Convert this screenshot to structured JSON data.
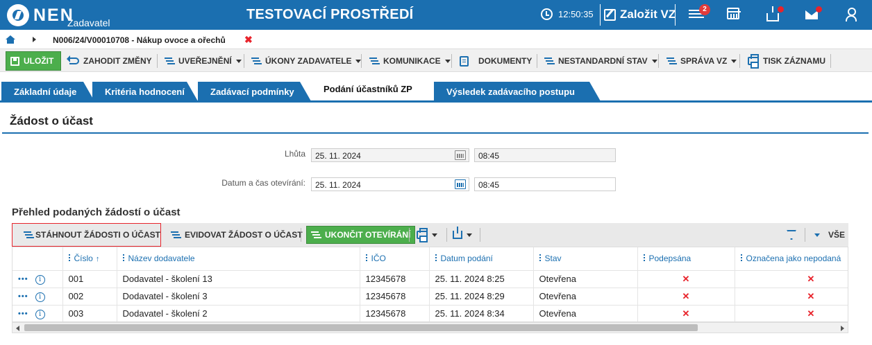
{
  "header": {
    "logo_text": "NEN",
    "logo_sub": "Zadavatel",
    "environment": "TESTOVACÍ PROSTŘEDÍ",
    "time": "12:50:35",
    "create_vz": "Založit VZ",
    "notifications_count": "2",
    "icons": [
      "clock-icon",
      "pen-icon",
      "menu-icon",
      "calendar-icon",
      "inbox-icon",
      "mail-icon",
      "user-icon"
    ],
    "accent_color": "#1b6fb0"
  },
  "breadcrumb": {
    "text": "N006/24/V00010708 - Nákup ovoce a ořechů",
    "close": "✖"
  },
  "toolbar": {
    "save": "ULOŽIT",
    "discard": "ZAHODIT ZMĚNY",
    "publish": "UVEŘEJNĚNÍ",
    "actions": "ÚKONY ZADAVATELE",
    "communication": "KOMUNIKACE",
    "documents": "DOKUMENTY",
    "nonstandard": "NESTANDARDNÍ STAV",
    "management": "SPRÁVA VZ",
    "print": "TISK ZÁZNAMU"
  },
  "tabs": [
    {
      "label": "Základní údaje",
      "active": false
    },
    {
      "label": "Kritéria hodnocení",
      "active": false
    },
    {
      "label": "Zadávací podmínky",
      "active": false
    },
    {
      "label": "Podání účastníků ZP",
      "active": true
    },
    {
      "label": "Výsledek zadávacího postupu",
      "active": false
    }
  ],
  "section": {
    "title": "Žádost o účast",
    "deadline_label": "Lhůta",
    "deadline_date": "25. 11. 2024",
    "deadline_time": "08:45",
    "opening_label": "Datum a čas otevírání:",
    "opening_date": "25. 11. 2024",
    "opening_time": "08:45"
  },
  "overview": {
    "title": "Přehled podaných žádostí o účast",
    "download": "STÁHNOUT ŽÁDOSTI O ÚČAST",
    "register": "EVIDOVAT ŽÁDOST O ÚČAST",
    "finish": "UKONČIT OTEVÍRÁNÍ",
    "filter_all": "VŠE"
  },
  "table": {
    "columns": [
      "Číslo",
      "Název dodavatele",
      "IČO",
      "Datum podání",
      "Stav",
      "Podepsána",
      "Označena jako nepodaná"
    ],
    "sort_indicator": "↑",
    "row_menu": "•••",
    "row_info": "i",
    "rows": [
      {
        "cislo": "001",
        "nazev": "Dodavatel - školení 13",
        "ico": "12345678",
        "datum": "25. 11. 2024 8:25",
        "stav": "Otevřena",
        "podepsana": "✕",
        "nepodana": "✕"
      },
      {
        "cislo": "002",
        "nazev": "Dodavatel - školení 3",
        "ico": "12345678",
        "datum": "25. 11. 2024 8:29",
        "stav": "Otevřena",
        "podepsana": "✕",
        "nepodana": "✕"
      },
      {
        "cislo": "003",
        "nazev": "Dodavatel - školení 2",
        "ico": "12345678",
        "datum": "25. 11. 2024 8:34",
        "stav": "Otevřena",
        "podepsana": "✕",
        "nepodana": "✕"
      }
    ]
  }
}
